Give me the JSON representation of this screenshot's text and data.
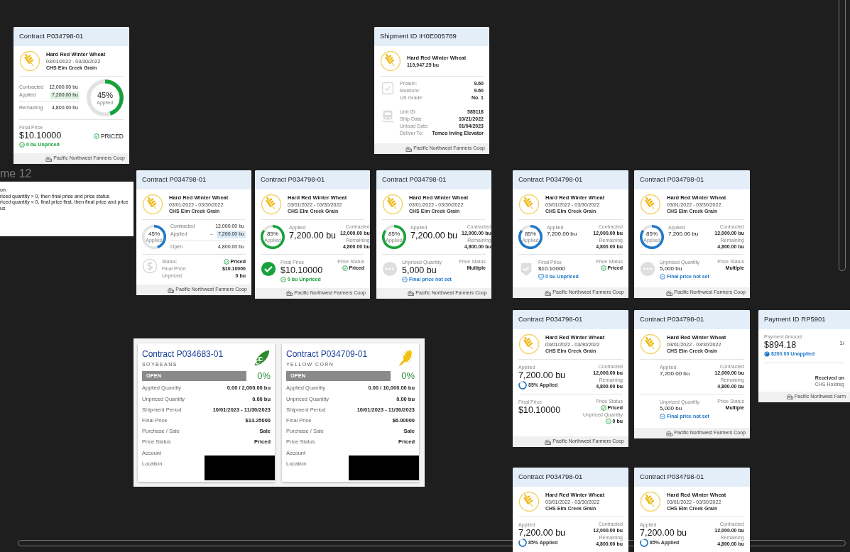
{
  "frame": {
    "label": "me 12",
    "note_lines": [
      "on",
      "riced quantity > 0, then final price and price status",
      "riced quantity < 0, final price first, then final price and price",
      "us"
    ]
  },
  "cards": [
    {
      "title": "Contract P034798-01",
      "commodity": {
        "name": "Hard Red Winter Wheat",
        "lines": [
          "03/01/2022 - 03/30/2022",
          "CHS Elm Creek Grain"
        ]
      },
      "sections": [
        {
          "kind": "ring_rows",
          "ring": {
            "kind": "large",
            "level": 0.45,
            "percent": "45%",
            "caption": "Applied",
            "color": "#17a33b"
          },
          "rows": [
            {
              "kind": "plain",
              "label": "Contracted",
              "value": "12,000.00 bu"
            },
            {
              "kind": "highlight",
              "label": "Applied",
              "value": "7,200.00 bu",
              "color": "#e0f2e3"
            },
            {
              "kind": "total",
              "label": "Remaining",
              "value": "4,800.00 bu"
            }
          ]
        },
        {
          "kind": "metric",
          "label": "Final Price",
          "value": "$10.10000",
          "large": true,
          "note": {
            "kind": "priced",
            "text": "0 bu Unpriced"
          },
          "side": [
            {
              "kind": "badge",
              "value": "PRICED"
            }
          ]
        }
      ],
      "footer": "Pacific Northwest Farmers Coop"
    },
    {
      "title": "Shipment ID IH0E005789",
      "commodity": {
        "name": "Hard Red Winter Wheat",
        "lines": [
          "119,947.25 bu"
        ]
      },
      "sections": [
        {
          "kind": "emblem_rows",
          "emblem": {
            "kind": "clipboard"
          },
          "rows": [
            {
              "kind": "plain",
              "label": "Protein:",
              "value": "9.60"
            },
            {
              "kind": "plain",
              "label": "Moisture:",
              "value": "9.60"
            },
            {
              "kind": "plain",
              "label": "US Grade:",
              "value": "No. 1"
            }
          ]
        },
        {
          "kind": "emblem_rows",
          "emblem": {
            "kind": "train"
          },
          "rows": [
            {
              "kind": "plain",
              "label": "Unit ID:",
              "value": "585118"
            },
            {
              "kind": "plain",
              "label": "Ship Date:",
              "value": "10/21/2022"
            },
            {
              "kind": "plain",
              "label": "Unload Date:",
              "value": "01/04/2023"
            },
            {
              "kind": "plain",
              "label": "Deliver To:",
              "value": "Temco Irving Elevator"
            }
          ]
        }
      ],
      "footer": "Pacific Northwest Farmers Coop"
    },
    {
      "title": "Contract P034798-01",
      "commodity": {
        "name": "Hard Red Winter Wheat",
        "lines": [
          "03/01/2022 - 03/30/2022",
          "CHS Elm Creek Grain"
        ]
      },
      "sections": [
        {
          "kind": "ring_rows",
          "ring": {
            "kind": "small",
            "level": 0.45,
            "percent": "45%",
            "caption": "Applied",
            "color": "#1f78c8"
          },
          "rows": [
            {
              "kind": "plain",
              "label": "Contracted",
              "value": "12,000.00 bu"
            },
            {
              "kind": "highlight",
              "label": "Applied",
              "marker": "–",
              "value": "7,200.00 bu",
              "color": "#dcebf8"
            },
            {
              "kind": "total",
              "label": "Open",
              "value": "4,800.00 bu"
            }
          ]
        },
        {
          "kind": "emblem_rows",
          "emblem": {
            "kind": "dollar"
          },
          "rows": [
            {
              "kind": "status",
              "label": "Status:",
              "value": "Priced"
            },
            {
              "kind": "plain",
              "label": "Final Price:",
              "value": "$10.10000"
            },
            {
              "kind": "plain",
              "label": "Unpriced:",
              "value": "0 bu"
            }
          ]
        }
      ],
      "footer": "Pacific Northwest Farmers Coop"
    },
    {
      "title": "Contract P034798-01",
      "commodity": {
        "name": "Hard Red Winter Wheat",
        "lines": [
          "03/01/2022 - 03/30/2022",
          "CHS Elm Creek Grain"
        ]
      },
      "sections": [
        {
          "kind": "metric",
          "ring": {
            "kind": "small",
            "level": 0.85,
            "percent": "85%",
            "caption": "Applied",
            "color": "#17a33b"
          },
          "label": "Applied",
          "value": "7,200.00 bu",
          "large": true,
          "side": [
            {
              "kind": "plain",
              "label": "Contracted",
              "value": "12,000.00 bu"
            },
            {
              "kind": "plain",
              "label": "Remaining",
              "value": "4,800.00 bu"
            }
          ]
        },
        {
          "kind": "metric",
          "emblem": {
            "kind": "check"
          },
          "label": "Final Price",
          "value": "$10.10000",
          "large": true,
          "note": {
            "kind": "priced",
            "text": "0 bu Unpriced"
          },
          "side": [
            {
              "kind": "status",
              "label": "Price Status",
              "value": "Priced"
            }
          ]
        }
      ],
      "footer": "Pacific Northwest Farmers Coop"
    },
    {
      "title": "Contract P034798-01",
      "commodity": {
        "name": "Hard Red Winter Wheat",
        "lines": [
          "03/01/2022 - 03/30/2022",
          "CHS Elm Creek Grain"
        ]
      },
      "sections": [
        {
          "kind": "metric",
          "ring": {
            "kind": "small",
            "level": 0.85,
            "percent": "85%",
            "caption": "Applied",
            "color": "#17a33b"
          },
          "label": "Applied",
          "value": "7,200.00 bu",
          "large": true,
          "side": [
            {
              "kind": "plain",
              "label": "Contracted",
              "value": "12,000.00 bu"
            },
            {
              "kind": "plain",
              "label": "Remaining",
              "value": "4,800.00 bu"
            }
          ]
        },
        {
          "kind": "metric",
          "emblem": {
            "kind": "dots"
          },
          "label": "Unpriced Quantity",
          "value": "5,000 bu",
          "large": true,
          "note": {
            "kind": "unset",
            "text": "Final price not set"
          },
          "side": [
            {
              "kind": "plain",
              "label": "Price Status",
              "value": "Multiple"
            }
          ]
        }
      ],
      "footer": "Pacific Northwest Farmers Coop"
    },
    {
      "title": "Contract P034798-01",
      "commodity": {
        "name": "Hard Red Winter Wheat",
        "lines": [
          "03/01/2022 - 03/30/2022",
          "CHS Elm Creek Grain"
        ]
      },
      "sections": [
        {
          "kind": "metric",
          "ring": {
            "kind": "small",
            "level": 0.85,
            "percent": "85%",
            "caption": "Applied",
            "color": "#1f78c8"
          },
          "label": "Applied",
          "value": "7,200.00 bu",
          "large": false,
          "side": [
            {
              "kind": "plain",
              "label": "Contracted",
              "value": "12,000.00 bu"
            },
            {
              "kind": "plain",
              "label": "Remaining",
              "value": "4,800.00 bu"
            }
          ]
        },
        {
          "kind": "metric",
          "emblem": {
            "kind": "shield"
          },
          "label": "Final Price",
          "value": "$10.10000",
          "large": false,
          "note": {
            "kind": "shield",
            "text": "0 bu Unpriced"
          },
          "side": [
            {
              "kind": "status",
              "label": "Price Status",
              "value": "Priced"
            }
          ]
        }
      ],
      "footer": "Pacific Northwest Farmers Coop"
    },
    {
      "title": "Contract P034798-01",
      "commodity": {
        "name": "Hard Red Winter Wheat",
        "lines": [
          "03/01/2022 - 03/30/2022",
          "CHS Elm Creek Grain"
        ]
      },
      "sections": [
        {
          "kind": "metric",
          "ring": {
            "kind": "small",
            "level": 0.85,
            "percent": "85%",
            "caption": "Applied",
            "color": "#1f78c8"
          },
          "label": "Applied",
          "value": "7,200.00 bu",
          "large": false,
          "side": [
            {
              "kind": "plain",
              "label": "Contracted",
              "value": "12,000.00 bu"
            },
            {
              "kind": "plain",
              "label": "Remaining",
              "value": "4,800.00 bu"
            }
          ]
        },
        {
          "kind": "metric",
          "emblem": {
            "kind": "dots"
          },
          "label": "Unpriced Quantity",
          "value": "5,000 bu",
          "large": false,
          "note": {
            "kind": "unset",
            "text": "Final price not set"
          },
          "side": [
            {
              "kind": "plain",
              "label": "Price Status",
              "value": "Multiple"
            }
          ]
        }
      ],
      "footer": "Pacific Northwest Farmers Coop"
    },
    {
      "title": "Contract P034798-01",
      "commodity": {
        "name": "Hard Red Winter Wheat",
        "lines": [
          "03/01/2022 - 03/30/2022",
          "CHS Elm Creek Grain"
        ]
      },
      "sections": [
        {
          "kind": "metric",
          "label": "Applied",
          "value": "7,200.00 bu",
          "large": true,
          "note": {
            "kind": "progress",
            "text": "85% Applied",
            "level": 0.85
          },
          "side": [
            {
              "kind": "plain",
              "label": "Contracted",
              "value": "12,000.00 bu"
            },
            {
              "kind": "plain",
              "label": "Remaining",
              "value": "4,800.00 bu"
            }
          ]
        },
        {
          "kind": "metric",
          "label": "Final Price",
          "value": "$10.10000",
          "large": true,
          "side": [
            {
              "kind": "status",
              "label": "Price Status",
              "value": "Priced"
            },
            {
              "kind": "status",
              "label": "Unpriced Quantity",
              "value": "0 bu"
            }
          ]
        }
      ],
      "footer": "Pacific Northwest Farmers Coop"
    },
    {
      "title": "Contract P034798-01",
      "commodity": {
        "name": "Hard Red Winter Wheat",
        "lines": [
          "03/01/2022 - 03/30/2022",
          "CHS Elm Creek Grain"
        ]
      },
      "sections": [
        {
          "kind": "metric",
          "emblem": {
            "kind": "blank"
          },
          "label": "Applied",
          "value": "7,200.00 bu",
          "large": false,
          "side": [
            {
              "kind": "plain",
              "label": "Contracted",
              "value": "12,000.00 bu"
            },
            {
              "kind": "plain",
              "label": "Remaining",
              "value": "4,800.00 bu"
            }
          ]
        },
        {
          "kind": "metric",
          "emblem": {
            "kind": "blank"
          },
          "label": "Unpriced Quantity",
          "value": "5,000 bu",
          "large": false,
          "note": {
            "kind": "unset",
            "text": "Final price not set"
          },
          "side": [
            {
              "kind": "plain",
              "label": "Price Status",
              "value": "Multiple"
            }
          ]
        }
      ],
      "footer": "Pacific Northwest Farmers Coop"
    },
    {
      "title": "Payment ID RP5901",
      "sections": [
        {
          "kind": "metric",
          "label": "Payment Amount",
          "value": "$894.18",
          "large": true,
          "note": {
            "kind": "unapplied",
            "text": "$200.00 Unapplied"
          },
          "side": [
            {
              "kind": "plain",
              "value": "1/"
            }
          ]
        },
        {
          "kind": "lines",
          "lines": [
            "Received on",
            "CHS Holdreg"
          ]
        }
      ],
      "footer": "Pacific Northwest Farm"
    },
    {
      "title": "Contract P034798-01",
      "commodity": {
        "name": "Hard Red Winter Wheat",
        "lines": [
          "03/01/2022 - 03/30/2022",
          "CHS Elm Creek Grain"
        ]
      },
      "sections": [
        {
          "kind": "metric",
          "label": "Applied",
          "value": "7,200.00 bu",
          "large": true,
          "note": {
            "kind": "progress",
            "text": "85% Applied",
            "level": 0.85
          },
          "side": [
            {
              "kind": "plain",
              "label": "Contracted",
              "value": "12,000.00 bu"
            },
            {
              "kind": "plain",
              "label": "Remaining",
              "value": "4,800.00 bu"
            }
          ]
        }
      ]
    },
    {
      "title": "Contract P034798-01",
      "commodity": {
        "name": "Hard Red Winter Wheat",
        "lines": [
          "03/01/2022 - 03/30/2022",
          "CHS Elm Creek Grain"
        ]
      },
      "sections": [
        {
          "kind": "metric",
          "label": "Applied",
          "value": "7,200.00 bu",
          "large": true,
          "note": {
            "kind": "progress",
            "text": "85% Applied",
            "level": 0.85
          },
          "side": [
            {
              "kind": "plain",
              "label": "Contracted",
              "value": "12,000.00 bu"
            },
            {
              "kind": "plain",
              "label": "Remaining",
              "value": "4,800.00 bu"
            }
          ]
        }
      ]
    }
  ],
  "summary_cards": [
    {
      "title": "Contract P034683-01",
      "crop": "SOYBEANS",
      "crop_icon": {
        "kind": "soybean"
      },
      "status": "OPEN",
      "percent": "0%",
      "redacted": true,
      "rows": [
        {
          "label": "Applied Quantity",
          "value": "0.00 / 2,000.00 bu"
        },
        {
          "label": "Unpriced Quantity",
          "value": "0.00 bu"
        },
        {
          "label": "Shipment Period",
          "value": "10/01/2023 - 11/30/2023"
        },
        {
          "label": "Final Price",
          "value": "$13.25000"
        },
        {
          "label": "Purchase / Sale",
          "value": "Sale"
        },
        {
          "label": "Price Status",
          "value": "Priced"
        },
        {
          "label": "Account"
        },
        {
          "label": "Location"
        }
      ]
    },
    {
      "title": "Contract P034709-01",
      "crop": "YELLOW CORN",
      "crop_icon": {
        "kind": "corn"
      },
      "status": "OPEN",
      "percent": "0%",
      "redacted": true,
      "rows": [
        {
          "label": "Applied Quantity",
          "value": "0.00 / 10,000.00 bu"
        },
        {
          "label": "Unpriced Quantity",
          "value": "0.00 bu"
        },
        {
          "label": "Shipment Period",
          "value": "10/01/2023 - 11/30/2023"
        },
        {
          "label": "Final Price",
          "value": "$6.00000"
        },
        {
          "label": "Purchase / Sale",
          "value": "Sale"
        },
        {
          "label": "Price Status",
          "value": "Priced"
        },
        {
          "label": "Account"
        },
        {
          "label": "Location"
        }
      ]
    }
  ]
}
